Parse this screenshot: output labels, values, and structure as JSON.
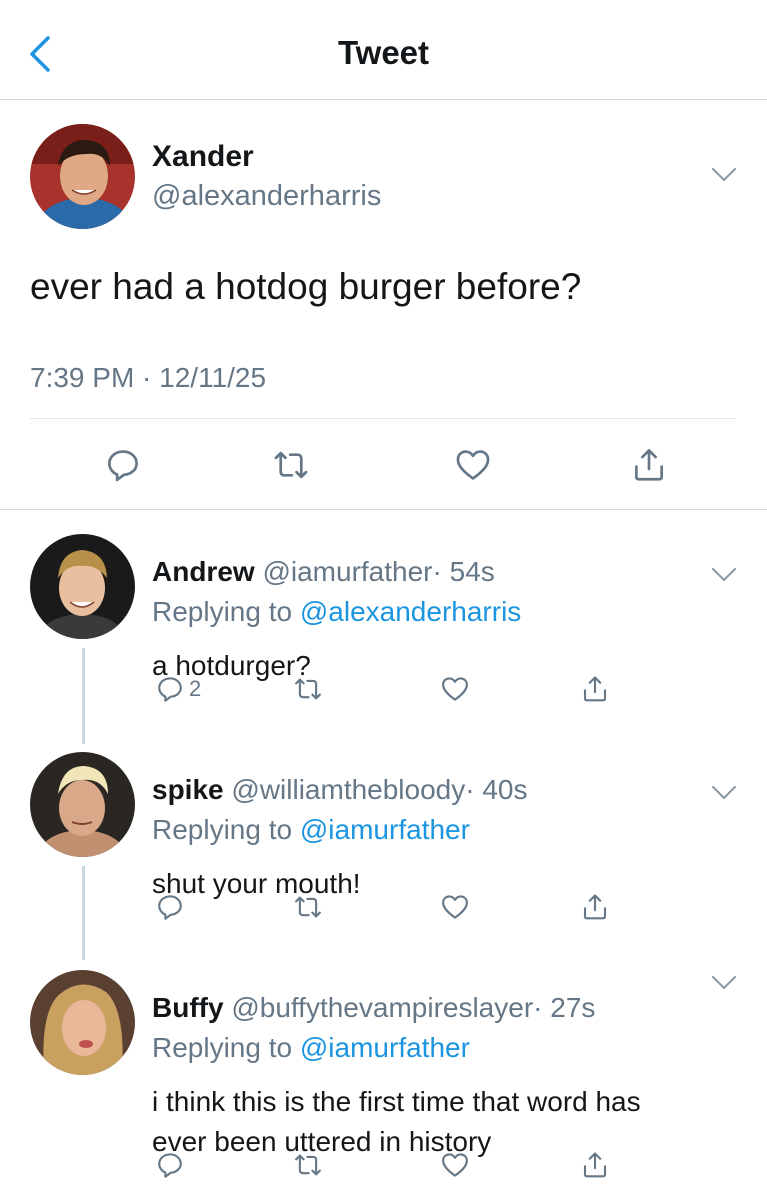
{
  "header": {
    "title": "Tweet"
  },
  "tweet": {
    "name": "Xander",
    "handle": "@alexanderharris",
    "text": "ever had a hotdog burger before?",
    "timestamp": "7:39 PM · 12/11/25"
  },
  "replies": [
    {
      "name": "Andrew",
      "handle": "@iamurfather",
      "age": "· 54s",
      "replying_label": "Replying to",
      "replying_to": "@alexanderharris",
      "text": "a hotdurger?",
      "reply_count": "2"
    },
    {
      "name": "spike",
      "handle": "@williamthebloody",
      "age": "· 40s",
      "replying_label": "Replying to",
      "replying_to": "@iamurfather",
      "text": "shut your mouth!",
      "reply_count": ""
    },
    {
      "name": "Buffy",
      "handle": "@buffythevampireslayer",
      "age": "· 27s",
      "replying_label": "Replying to",
      "replying_to": "@iamurfather",
      "text_line1": "i think this is the first time that word has",
      "text_line2": "ever been uttered in history",
      "reply_count": ""
    }
  ],
  "colors": {
    "link": "#1b95e0",
    "secondary_text": "#657786",
    "divider": "#d4d8db"
  },
  "icons": [
    "back-icon",
    "chevron-down-icon",
    "reply-icon",
    "retweet-icon",
    "like-icon",
    "share-icon"
  ]
}
